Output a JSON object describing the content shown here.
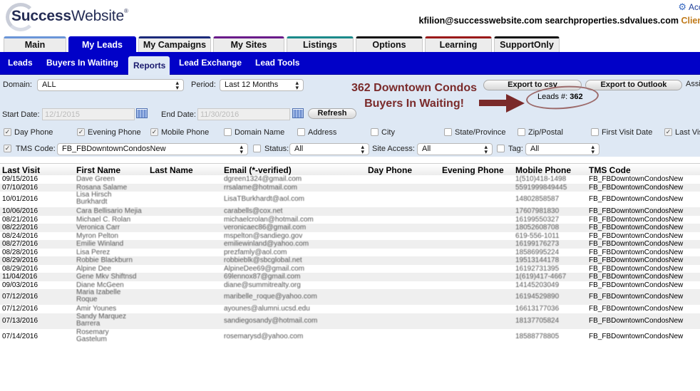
{
  "header": {
    "logo": {
      "bold": "Success",
      "regular": "Website",
      "mark": "®"
    },
    "account_link": "Acc",
    "user_email": "kfilion@successwebsite.com",
    "site": "searchproperties.sdvalues.com",
    "client_label": "Clien"
  },
  "tabs": [
    {
      "label": "Main",
      "active": false,
      "color": "#6a95d8"
    },
    {
      "label": "My Leads",
      "active": true,
      "color": "#0101c8"
    },
    {
      "label": "My Campaigns",
      "active": false,
      "color": "#1b2a7a"
    },
    {
      "label": "My Sites",
      "active": false,
      "color": "#6a1b8a"
    },
    {
      "label": "Listings",
      "active": false,
      "color": "#1b8a8a"
    },
    {
      "label": "Options",
      "active": false,
      "color": "#111111"
    },
    {
      "label": "Learning",
      "active": false,
      "color": "#9a1a1a"
    },
    {
      "label": "SupportOnly",
      "active": false,
      "color": "#111111"
    }
  ],
  "subnav": [
    {
      "label": "Leads",
      "active": false
    },
    {
      "label": "Buyers In Waiting",
      "active": false
    },
    {
      "label": "Reports",
      "active": true
    },
    {
      "label": "Lead Exchange",
      "active": false
    },
    {
      "label": "Lead Tools",
      "active": false
    }
  ],
  "filters": {
    "domain_label": "Domain:",
    "domain_value": "ALL",
    "period_label": "Period:",
    "period_value": "Last 12 Months",
    "start_date_label": "Start Date:",
    "start_date_value": "12/1/2015",
    "end_date_label": "End Date:",
    "end_date_value": "11/30/2016",
    "refresh_label": "Refresh",
    "export_csv_label": "Export to csv",
    "export_outlook_label": "Export to Outlook",
    "assign_label": "Assi",
    "leads_count_label": "Leads #:",
    "leads_count_value": "362",
    "column_checkboxes": [
      {
        "label": "Day Phone",
        "checked": true
      },
      {
        "label": "Evening Phone",
        "checked": true
      },
      {
        "label": "Mobile Phone",
        "checked": true
      },
      {
        "label": "Domain Name",
        "checked": false
      },
      {
        "label": "Address",
        "checked": false
      },
      {
        "label": "City",
        "checked": false
      },
      {
        "label": "State/Province",
        "checked": false
      },
      {
        "label": "Zip/Postal",
        "checked": false
      },
      {
        "label": "First Visit Date",
        "checked": false
      },
      {
        "label": "Last Vis",
        "checked": true
      }
    ],
    "tms_code_label": "TMS Code:",
    "tms_code_checked": true,
    "tms_code_value": "FB_FBDowntownCondosNew",
    "status_label": "Status:",
    "status_checked": false,
    "status_value": "All",
    "site_access_label": "Site Access:",
    "site_access_value": "All",
    "tag_label": "Tag:",
    "tag_checked": false,
    "tag_value": "All"
  },
  "annotation": {
    "line1": "362 Downtown Condos",
    "line2": "Buyers In Waiting!",
    "color": "#7a2a2a"
  },
  "table": {
    "columns": [
      "Last Visit",
      "First Name",
      "Last Name",
      "Email (*-verified)",
      "Day Phone",
      "Evening Phone",
      "Mobile Phone",
      "TMS Code"
    ],
    "rows": [
      {
        "last_visit": "09/15/2016",
        "first_name": "Dave Green",
        "last_name": "",
        "email": "dgreen1324@gmail.com",
        "day_phone": "",
        "evening_phone": "",
        "mobile_phone": "1(510)418-1498",
        "tms_code": "FB_FBDowntownCondosNew"
      },
      {
        "last_visit": "07/10/2016",
        "first_name": "Rosana Salame",
        "last_name": "",
        "email": "rrsalame@hotmail.com",
        "day_phone": "",
        "evening_phone": "",
        "mobile_phone": "5591999849445",
        "tms_code": "FB_FBDowntownCondosNew"
      },
      {
        "last_visit": "10/01/2016",
        "first_name": "Lisa Hirsch Burkhardt",
        "last_name": "",
        "email": "LisaTBurkhardt@aol.com",
        "day_phone": "",
        "evening_phone": "",
        "mobile_phone": "14802858587",
        "tms_code": "FB_FBDowntownCondosNew"
      },
      {
        "last_visit": "10/06/2016",
        "first_name": "Cara Bellisario Mejia",
        "last_name": "",
        "email": "carabells@cox.net",
        "day_phone": "",
        "evening_phone": "",
        "mobile_phone": "17607981830",
        "tms_code": "FB_FBDowntownCondosNew"
      },
      {
        "last_visit": "08/21/2016",
        "first_name": "Michael C. Rolan",
        "last_name": "",
        "email": "michaelcrolan@hotmail.com",
        "day_phone": "",
        "evening_phone": "",
        "mobile_phone": "16199550327",
        "tms_code": "FB_FBDowntownCondosNew"
      },
      {
        "last_visit": "08/22/2016",
        "first_name": "Veronica Carr",
        "last_name": "",
        "email": "veronicaec86@gmail.com",
        "day_phone": "",
        "evening_phone": "",
        "mobile_phone": "18052608708",
        "tms_code": "FB_FBDowntownCondosNew"
      },
      {
        "last_visit": "08/24/2016",
        "first_name": "Myron Pelton",
        "last_name": "",
        "email": "mspelton@sandiego.gov",
        "day_phone": "",
        "evening_phone": "",
        "mobile_phone": "619-556-1011",
        "tms_code": "FB_FBDowntownCondosNew"
      },
      {
        "last_visit": "08/27/2016",
        "first_name": "Emilie Winland",
        "last_name": "",
        "email": "emiliewinland@yahoo.com",
        "day_phone": "",
        "evening_phone": "",
        "mobile_phone": "16199176273",
        "tms_code": "FB_FBDowntownCondosNew"
      },
      {
        "last_visit": "08/28/2016",
        "first_name": "Lisa Perez",
        "last_name": "",
        "email": "prezfamly@aol.com",
        "day_phone": "",
        "evening_phone": "",
        "mobile_phone": "18586995224",
        "tms_code": "FB_FBDowntownCondosNew"
      },
      {
        "last_visit": "08/29/2016",
        "first_name": "Robbie Blackburn",
        "last_name": "",
        "email": "robbieblk@sbcglobal.net",
        "day_phone": "",
        "evening_phone": "",
        "mobile_phone": "19513144178",
        "tms_code": "FB_FBDowntownCondosNew"
      },
      {
        "last_visit": "08/29/2016",
        "first_name": "Alpine Dee",
        "last_name": "",
        "email": "AlpineDee69@gmail.com",
        "day_phone": "",
        "evening_phone": "",
        "mobile_phone": "16192731395",
        "tms_code": "FB_FBDowntownCondosNew"
      },
      {
        "last_visit": "11/04/2016",
        "first_name": "Gene Mkv Shiftnsd",
        "last_name": "",
        "email": "69lennox87@gmail.com",
        "day_phone": "",
        "evening_phone": "",
        "mobile_phone": "1(619)417-4667",
        "tms_code": "FB_FBDowntownCondosNew"
      },
      {
        "last_visit": "09/03/2016",
        "first_name": "Diane McGeen",
        "last_name": "",
        "email": "diane@summitrealty.org",
        "day_phone": "",
        "evening_phone": "",
        "mobile_phone": "14145203049",
        "tms_code": "FB_FBDowntownCondosNew"
      },
      {
        "last_visit": "07/12/2016",
        "first_name": "Maria Izabelle Roque",
        "last_name": "",
        "email": "maribelle_roque@yahoo.com",
        "day_phone": "",
        "evening_phone": "",
        "mobile_phone": "16194529890",
        "tms_code": "FB_FBDowntownCondosNew"
      },
      {
        "last_visit": "07/12/2016",
        "first_name": "Amir Younes",
        "last_name": "",
        "email": "ayounes@alumni.ucsd.edu",
        "day_phone": "",
        "evening_phone": "",
        "mobile_phone": "16613177036",
        "tms_code": "FB_FBDowntownCondosNew"
      },
      {
        "last_visit": "07/13/2016",
        "first_name": "Sandy Marquez Barrera",
        "last_name": "",
        "email": "sandiegosandy@hotmail.com",
        "day_phone": "",
        "evening_phone": "",
        "mobile_phone": "18137705824",
        "tms_code": "FB_FBDowntownCondosNew"
      },
      {
        "last_visit": "07/14/2016",
        "first_name": "Rosemary Gastelum",
        "last_name": "",
        "email": "rosemarysd@yahoo.com",
        "day_phone": "",
        "evening_phone": "",
        "mobile_phone": "18588778805",
        "tms_code": "FB_FBDowntownCondosNew"
      }
    ]
  }
}
